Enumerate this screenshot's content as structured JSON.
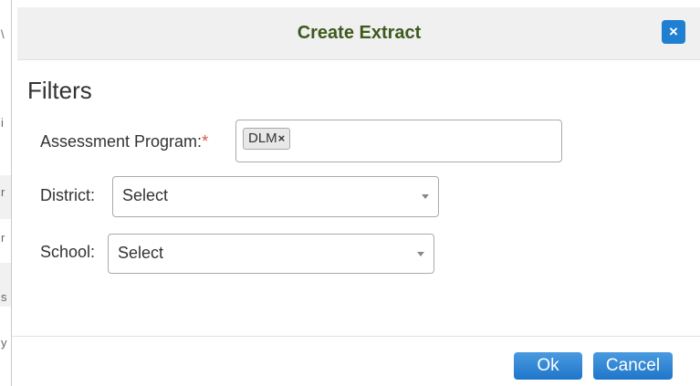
{
  "dialog": {
    "title": "Create Extract",
    "close_icon": "×"
  },
  "filters": {
    "heading": "Filters",
    "assessment_program": {
      "label": "Assessment Program:",
      "required_marker": "*",
      "selected_tags": [
        {
          "label": "DLM",
          "remove": "×"
        }
      ]
    },
    "district": {
      "label": "District:",
      "value": "Select"
    },
    "school": {
      "label": "School:",
      "value": "Select"
    }
  },
  "footer": {
    "ok_label": "Ok",
    "cancel_label": "Cancel"
  },
  "background_fragments": [
    "\\",
    "i",
    "r",
    "r",
    "s",
    "y"
  ],
  "colors": {
    "title_text": "#3d5a1c",
    "primary_button": "#1f76c9",
    "required": "#d9534f"
  }
}
